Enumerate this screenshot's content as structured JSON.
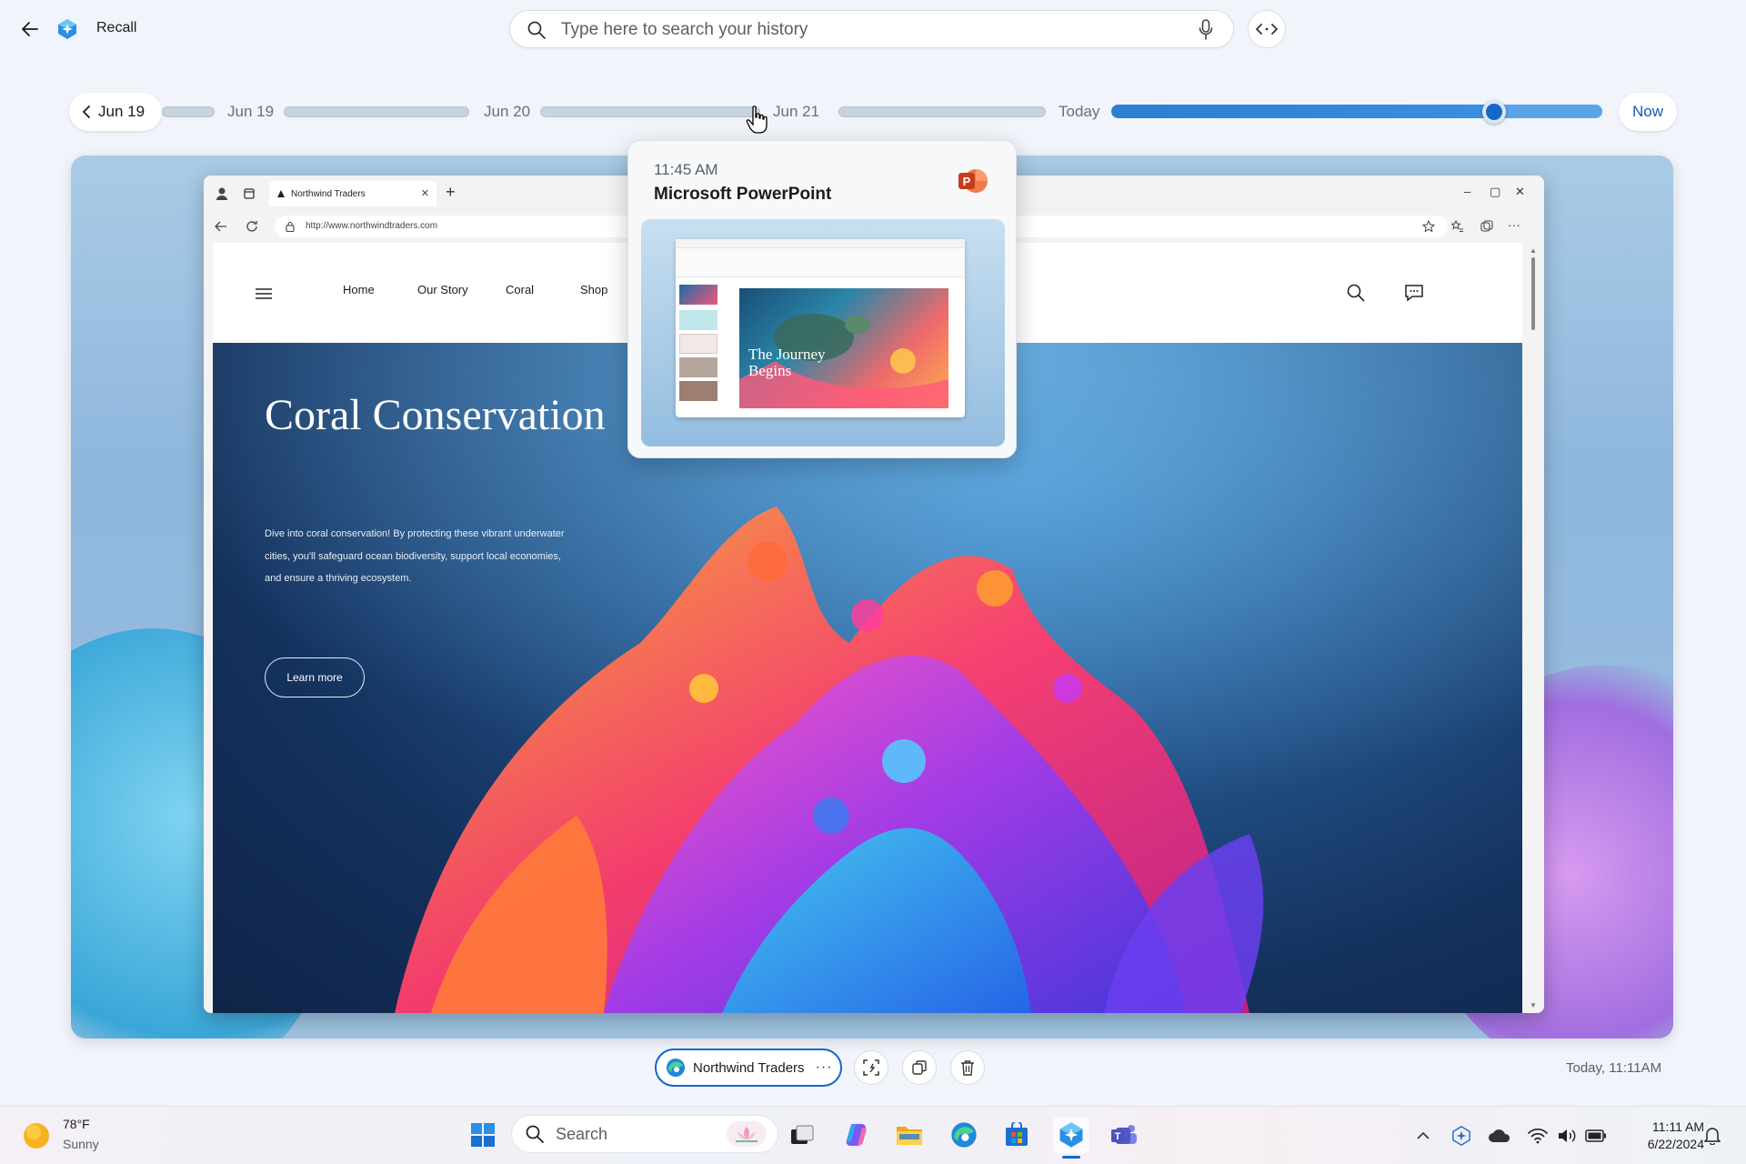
{
  "app": {
    "title": "Recall"
  },
  "search": {
    "placeholder": "Type here to search your history"
  },
  "timeline": {
    "prev_label": "Jun 19",
    "labels": [
      "Jun 19",
      "Jun 20",
      "Jun 21",
      "Today"
    ],
    "now_label": "Now",
    "position_fraction": 0.78
  },
  "browser": {
    "tab_title": "Northwind Traders",
    "url": "http://www.northwindtraders.com"
  },
  "website": {
    "nav": [
      "Home",
      "Our Story",
      "Coral",
      "Shop"
    ],
    "hero_title": "Coral Conservation",
    "hero_body": "Dive into coral conservation! By protecting these vibrant underwater cities, you'll safeguard ocean biodiversity, support local economies, and ensure a thriving ecosystem.",
    "cta": "Learn more"
  },
  "popup": {
    "time": "11:45 AM",
    "app_name": "Microsoft PowerPoint",
    "slide_text": "The Journey Begins"
  },
  "snapshot_bar": {
    "app_chip_label": "Northwind Traders",
    "more_label": "···",
    "timestamp": "Today, 11:11AM"
  },
  "taskbar": {
    "weather_temp": "78°F",
    "weather_cond": "Sunny",
    "search_label": "Search",
    "time": "11:11 AM",
    "date": "6/22/2024"
  },
  "colors": {
    "accent": "#1466c8",
    "powerpoint": "#d04423"
  }
}
